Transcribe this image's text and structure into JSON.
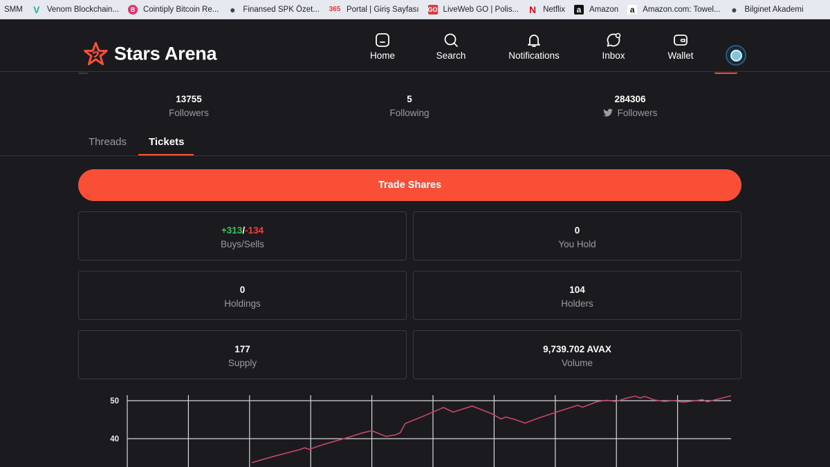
{
  "bookmarks": [
    {
      "label": "SMM",
      "icon": "none"
    },
    {
      "label": "Venom Blockchain...",
      "icon": "venom-icon",
      "color": "#1bb3a2"
    },
    {
      "label": "Cointiply Bitcoin Re...",
      "icon": "cointiply-icon",
      "color": "#e2336b"
    },
    {
      "label": "Finansed SPK Özet...",
      "icon": "globe-icon",
      "color": "#444444"
    },
    {
      "label": "Portal | Giriş Sayfası",
      "icon": "365-icon",
      "color": "#e03a3a"
    },
    {
      "label": "LiveWeb GO | Polis...",
      "icon": "go-icon",
      "color": "#e03a3a"
    },
    {
      "label": "Netflix",
      "icon": "netflix-icon",
      "color": "#e50914"
    },
    {
      "label": "Amazon",
      "icon": "amazon-icon",
      "color": "#111111"
    },
    {
      "label": "Amazon.com: Towel...",
      "icon": "amazon-icon",
      "color": "#ffffff"
    },
    {
      "label": "Bilginet Akademi",
      "icon": "globe-icon",
      "color": "#444444"
    }
  ],
  "app": {
    "name": "Stars Arena",
    "brand_color": "#fa4f37"
  },
  "nav": {
    "home": "Home",
    "search": "Search",
    "notifications": "Notifications",
    "inbox": "Inbox",
    "wallet": "Wallet"
  },
  "stats": {
    "followers": {
      "value": "13755",
      "label": "Followers"
    },
    "following": {
      "value": "5",
      "label": "Following"
    },
    "twitter": {
      "value": "284306",
      "label": "Followers",
      "icon": "twitter-icon"
    }
  },
  "tabs": {
    "threads": "Threads",
    "tickets": "Tickets",
    "active": "Tickets"
  },
  "trade_button": "Trade Shares",
  "cards": {
    "buys": "+313",
    "slash": "/",
    "sells": "-134",
    "buys_sells_label": "Buys/Sells",
    "you_hold_value": "0",
    "you_hold_label": "You Hold",
    "holdings_value": "0",
    "holdings_label": "Holdings",
    "holders_value": "104",
    "holders_label": "Holders",
    "supply_value": "177",
    "supply_label": "Supply",
    "volume_value": "9,739.702 AVAX",
    "volume_label": "Volume"
  },
  "chart_data": {
    "type": "line",
    "title": "",
    "xlabel": "",
    "ylabel": "",
    "ylim": [
      34,
      52
    ],
    "yticks": [
      "50",
      "40"
    ],
    "grid": true,
    "series": [
      {
        "color": "#c8486a",
        "points": [
          [
            0,
            33.7
          ],
          [
            5,
            35.5
          ],
          [
            10,
            37.1
          ],
          [
            11,
            37.6
          ],
          [
            12,
            37.2
          ],
          [
            15,
            38.5
          ],
          [
            20,
            40.3
          ],
          [
            23,
            41.5
          ],
          [
            25,
            42.1
          ],
          [
            28,
            40.6
          ],
          [
            30,
            41.0
          ],
          [
            31,
            41.6
          ],
          [
            32,
            44.0
          ],
          [
            35,
            45.5
          ],
          [
            40,
            48.2
          ],
          [
            42,
            47.0
          ],
          [
            44,
            47.8
          ],
          [
            46,
            48.6
          ],
          [
            50,
            46.6
          ],
          [
            52,
            45.2
          ],
          [
            53,
            45.7
          ],
          [
            55,
            45.0
          ],
          [
            57,
            44.1
          ],
          [
            60,
            45.5
          ],
          [
            65,
            47.6
          ],
          [
            68,
            48.8
          ],
          [
            69,
            48.3
          ],
          [
            72,
            49.7
          ],
          [
            74,
            50.1
          ],
          [
            76,
            49.8
          ],
          [
            78,
            50.6
          ],
          [
            80,
            51.2
          ],
          [
            81,
            50.7
          ],
          [
            82,
            51.1
          ],
          [
            84,
            50.2
          ],
          [
            86,
            49.8
          ],
          [
            88,
            50.0
          ],
          [
            90,
            49.6
          ],
          [
            92,
            49.9
          ],
          [
            94,
            50.3
          ],
          [
            95,
            49.7
          ],
          [
            100,
            51.3
          ]
        ]
      }
    ]
  }
}
